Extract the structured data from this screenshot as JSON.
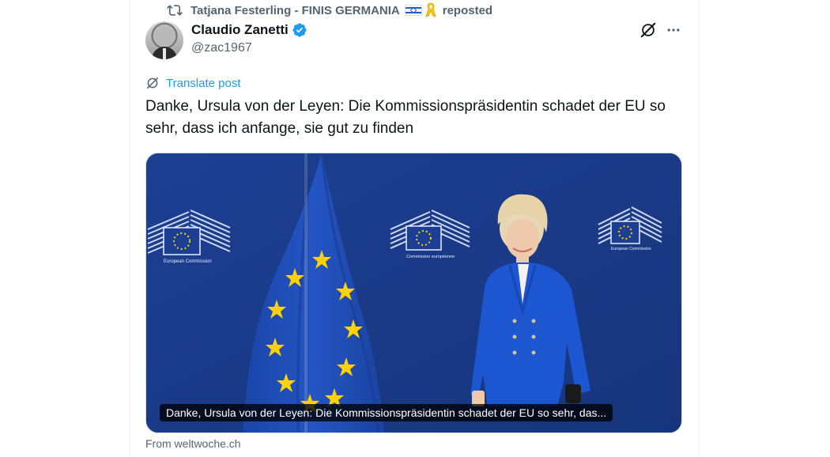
{
  "repost": {
    "icon": "repost-icon",
    "user": "Tatjana Festerling - FINIS GERMANIA",
    "emoji_icons": [
      "israel-flag-icon",
      "yellow-ribbon-icon"
    ],
    "label": "reposted"
  },
  "author": {
    "name": "Claudio Zanetti",
    "verified": true,
    "handle": "@zac1967"
  },
  "actions": {
    "grok_icon": "grok-icon",
    "more_icon": "more-icon"
  },
  "translate": {
    "label": "Translate post",
    "icon": "translate-icon"
  },
  "post": {
    "text": "Danke, Ursula von der Leyen: Die Kommissionspräsidentin schadet der EU so sehr, dass ich anfange, sie gut zu finden"
  },
  "card": {
    "image_signs": [
      "European Commission",
      "Commission européenne",
      "European Commission"
    ],
    "caption": "Danke, Ursula von der Leyen: Die Kommissionspräsidentin schadet der EU so sehr, das...",
    "source": "From weltwoche.ch"
  },
  "colors": {
    "accent": "#1d9bf0",
    "secondary_text": "#536471",
    "media_background": "#1b3d8f",
    "eu_flag": "#1f50b8",
    "eu_star": "#ffd200"
  }
}
